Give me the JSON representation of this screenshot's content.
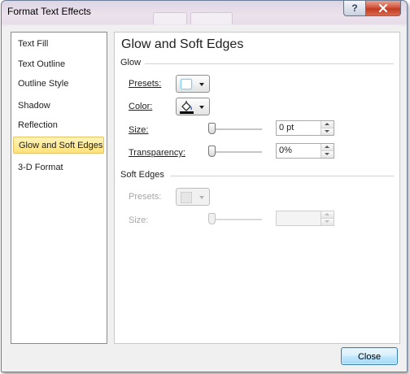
{
  "window": {
    "title": "Format Text Effects",
    "help_icon": "?",
    "close_icon": "x"
  },
  "categories": [
    {
      "label": "Text Fill",
      "selected": false
    },
    {
      "label": "Text Outline",
      "selected": false
    },
    {
      "label": "Outline Style",
      "selected": false
    },
    {
      "label": "Shadow",
      "selected": false
    },
    {
      "label": "Reflection",
      "selected": false
    },
    {
      "label": "Glow and Soft Edges",
      "selected": true
    },
    {
      "label": "3-D Format",
      "selected": false
    }
  ],
  "panel": {
    "title": "Glow and Soft Edges",
    "glow": {
      "heading": "Glow",
      "presets_label": "Presets:",
      "color_label": "Color:",
      "size_label": "Size:",
      "size_value": "0 pt",
      "transparency_label": "Transparency:",
      "transparency_value": "0%"
    },
    "soft_edges": {
      "heading": "Soft Edges",
      "presets_label": "Presets:",
      "size_label": "Size:",
      "size_value": ""
    }
  },
  "footer": {
    "close_label": "Close"
  },
  "colors": {
    "selected_item": "#fde27a",
    "glow_swatch": "#7fd0f6",
    "close_button": "#bee6fd",
    "title_close": "#c13b22"
  },
  "icons": {
    "help": "question-icon",
    "close": "close-icon",
    "glow_preset": "glow-preset-icon",
    "color_fill": "paint-bucket-icon",
    "dropdown": "chevron-down-icon",
    "spin": "spinner-arrows-icon"
  }
}
